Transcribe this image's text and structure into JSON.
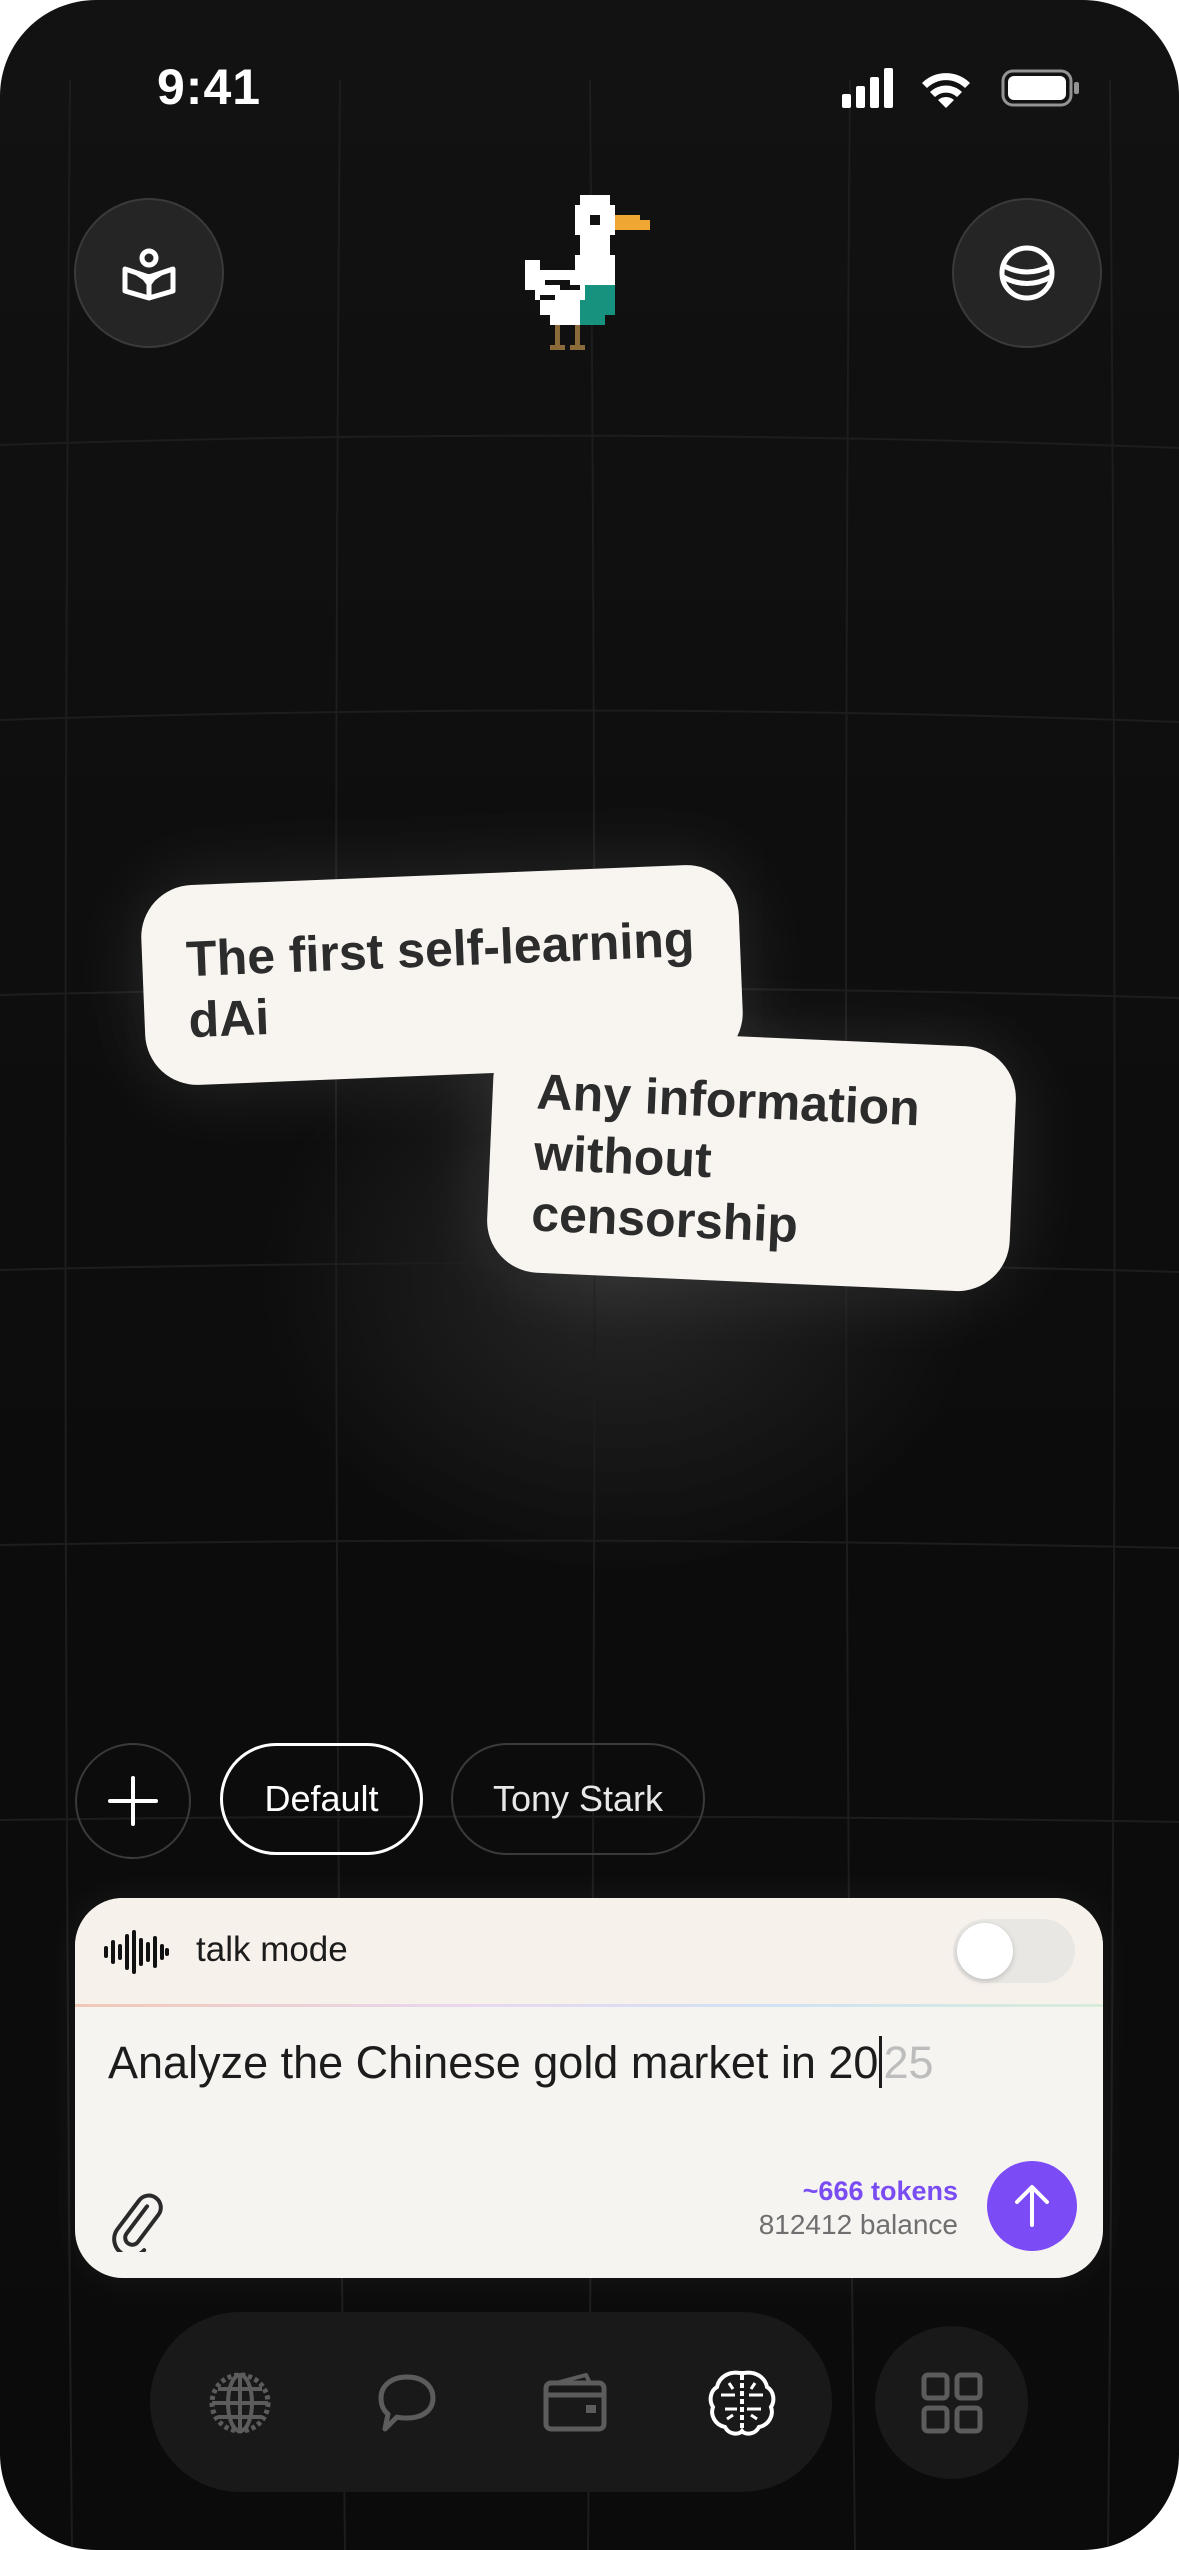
{
  "status_bar": {
    "time": "9:41"
  },
  "header": {
    "left_icon": "book-reader-icon",
    "logo": "pixel-duck-logo",
    "right_icon": "globe-icon"
  },
  "features": [
    {
      "text": "The first self-learning dAi"
    },
    {
      "text": "Any information without censorship"
    }
  ],
  "personas": {
    "add_icon": "plus-icon",
    "items": [
      {
        "label": "Default",
        "selected": true
      },
      {
        "label": "Tony Stark",
        "selected": false
      }
    ]
  },
  "composer": {
    "talk_mode_label": "talk mode",
    "talk_mode_on": false,
    "input_typed": "Analyze the Chinese gold market in 20",
    "input_suggestion": "25",
    "tokens_estimate": "~666 tokens",
    "balance": "812412 balance",
    "attach_icon": "paperclip-icon",
    "send_icon": "arrow-up-icon"
  },
  "bottom_nav": {
    "items": [
      {
        "icon": "globe-icon",
        "active": false
      },
      {
        "icon": "chat-bubble-icon",
        "active": false
      },
      {
        "icon": "wallet-icon",
        "active": false
      },
      {
        "icon": "brain-icon",
        "active": true
      }
    ],
    "apps_icon": "grid-icon"
  },
  "colors": {
    "accent": "#7b4bf6",
    "background": "#0e0e0e",
    "card": "#f8f5f1"
  }
}
